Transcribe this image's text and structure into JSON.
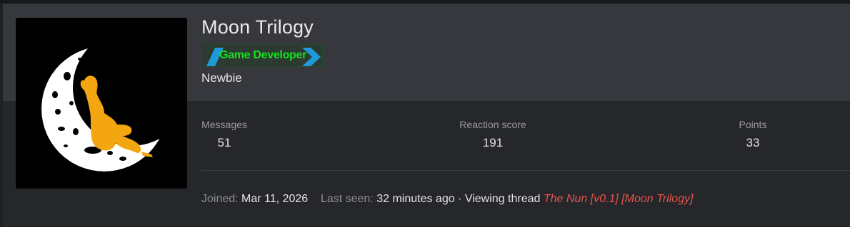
{
  "profile": {
    "username": "Moon Trilogy",
    "banner": "Game Developer",
    "user_title": "Newbie",
    "avatar_icon": "moon-girl-icon"
  },
  "stats": [
    {
      "label": "Messages",
      "value": "51"
    },
    {
      "label": "Reaction score",
      "value": "191"
    },
    {
      "label": "Points",
      "value": "33"
    }
  ],
  "footer": {
    "joined_label": "Joined:",
    "joined_value": "Mar 11, 2026",
    "last_seen_label": "Last seen:",
    "last_seen_value": "32 minutes ago",
    "separator": " · ",
    "activity": "Viewing thread",
    "thread_title": "The Nun [v0.1] [Moon Trilogy]"
  },
  "colors": {
    "banner_text": "#14e21e",
    "banner_chevron": "#1d9bd9",
    "thread_link": "#e5534b",
    "moon_figure": "#f3a60f"
  }
}
